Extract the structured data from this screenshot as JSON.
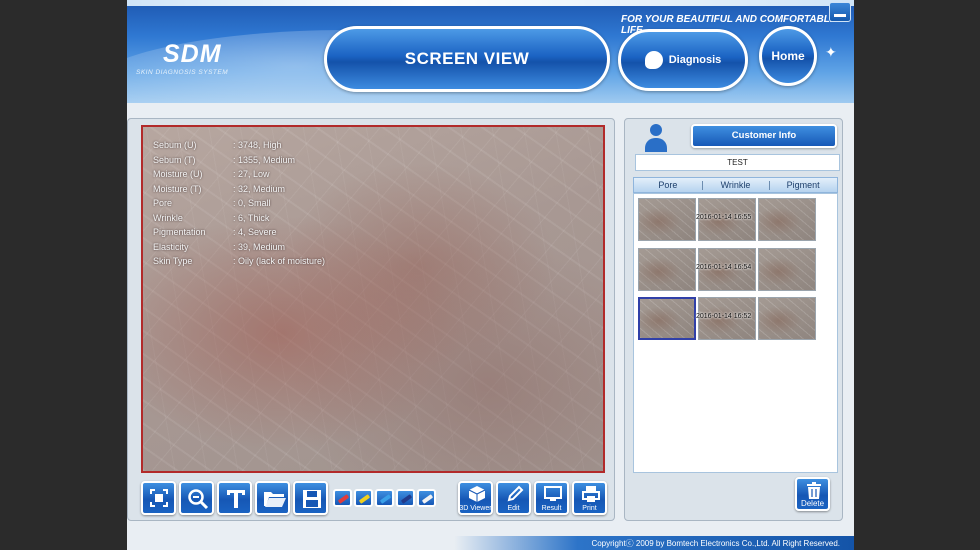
{
  "header": {
    "logo": "SDM",
    "logo_subtitle": "SKIN DIAGNOSIS SYSTEM",
    "tagline": "FOR YOUR BEAUTIFUL AND COMFORTABLE LIFE",
    "screen_view_label": "SCREEN VIEW",
    "diagnosis_label": "Diagnosis",
    "home_label": "Home"
  },
  "metrics": [
    {
      "label": "Sebum (U)",
      "value": ": 3748, High"
    },
    {
      "label": "Sebum (T)",
      "value": ": 1355, Medium"
    },
    {
      "label": "Moisture (U)",
      "value": ": 27, Low"
    },
    {
      "label": "Moisture (T)",
      "value": ": 32, Medium"
    },
    {
      "label": "Pore",
      "value": ": 0, Small"
    },
    {
      "label": "Wrinkle",
      "value": ": 6, Thick"
    },
    {
      "label": "Pigmentation",
      "value": ": 4, Severe"
    },
    {
      "label": "Elasticity",
      "value": ": 39, Medium"
    },
    {
      "label": "Skin Type",
      "value": ": Oily (lack of moisture)"
    }
  ],
  "toolbar": {
    "viewer_3d_label": "3D Viewer",
    "edit_label": "Edit",
    "result_label": "Result",
    "print_label": "Print"
  },
  "customer": {
    "info_button_label": "Customer Info",
    "name": "TEST"
  },
  "tabs": [
    {
      "label": "Pore"
    },
    {
      "label": "Wrinkle"
    },
    {
      "label": "Pigment"
    }
  ],
  "records": [
    {
      "date": "2016-01-14 16:55"
    },
    {
      "date": "2016-01-14 16:54"
    },
    {
      "date": "2016-01-14 16:52"
    }
  ],
  "delete_label": "Delete",
  "footer": {
    "copyright": "Copyrightⓒ 2009 by Bomtech Electronics Co.,Ltd.  All Right Reserved."
  },
  "colors": {
    "accent_blue": "#1b63c3",
    "frame_red": "#b22a2a",
    "selected_border": "#3040a8"
  },
  "pen_colors": [
    "#e23b3b",
    "#f0d020",
    "#3aa0e8",
    "#223a8a",
    "#f2f2f2"
  ]
}
